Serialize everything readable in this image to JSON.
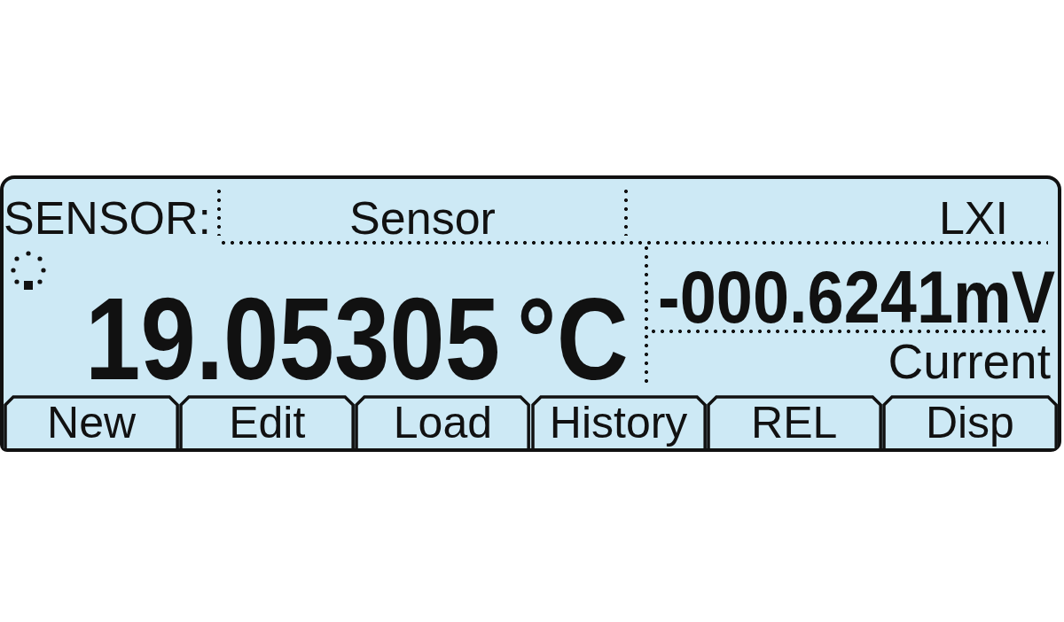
{
  "header": {
    "label": "SENSOR:",
    "title": "Sensor",
    "indicator": "LXI"
  },
  "primary": {
    "value": "19.05305",
    "unit": "°C"
  },
  "secondary": {
    "value": "-000.6241mV",
    "label": "Current"
  },
  "softkeys": [
    "New",
    "Edit",
    "Load",
    "History",
    "REL",
    "Disp"
  ]
}
